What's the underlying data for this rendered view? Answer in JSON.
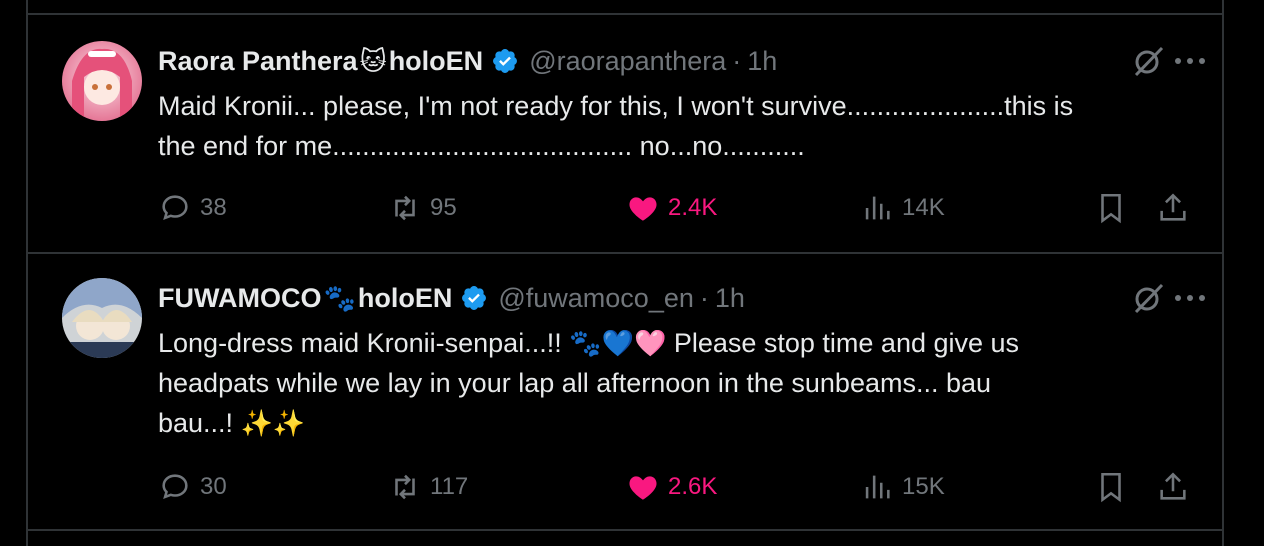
{
  "tweets": [
    {
      "display_name": "Raora Panthera",
      "name_emoji": "🐱",
      "name_suffix": "holoEN",
      "handle": "@raorapanthera",
      "separator": "·",
      "time": "1h",
      "text_line1": "Maid Kronii... please, I'm not ready for this, I won't survive.....................this is",
      "text_line2": "the end for me........................................ no...no...........",
      "replies": "38",
      "reposts": "95",
      "likes": "2.4K",
      "views": "14K",
      "avatar_colors": [
        "#f3b7c8",
        "#e36d8f"
      ]
    },
    {
      "display_name": "FUWAMOCO",
      "name_emoji": "🐾",
      "name_suffix": "holoEN",
      "handle": "@fuwamoco_en",
      "separator": "·",
      "time": "1h",
      "text_line1_a": "Long-dress maid Kronii-senpai...!! ",
      "text_line1_emoji": "🐾💙🩷",
      "text_line1_b": " Please stop time and give us",
      "text_line2": "headpats while we lay in your lap all afternoon in the sunbeams... bau",
      "text_line3_a": "bau...! ",
      "text_line3_emoji": "✨✨",
      "replies": "30",
      "reposts": "117",
      "likes": "2.6K",
      "views": "15K",
      "avatar_colors": [
        "#d9d6cf",
        "#8fa6c9"
      ]
    }
  ],
  "colors": {
    "background": "#000000",
    "border": "#2f3336",
    "text": "#e7e9ea",
    "muted": "#71767b",
    "like": "#f91880",
    "verified": "#1d9bf0"
  }
}
